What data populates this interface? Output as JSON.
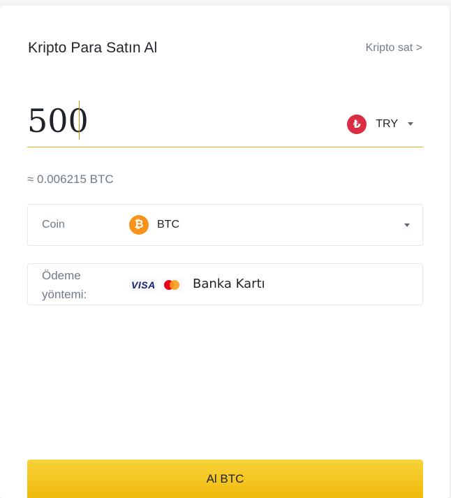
{
  "header": {
    "title": "Kripto Para Satın Al",
    "sell_link": "Kripto sat >"
  },
  "amount": {
    "value": "500",
    "currency_code": "TRY",
    "currency_symbol": "₺",
    "currency_icon": "turkish-lira-icon",
    "currency_color": "#d92d42"
  },
  "estimate": "≈ 0.006215 BTC",
  "coin": {
    "label": "Coin",
    "name": "BTC",
    "symbol": "₿",
    "icon": "bitcoin-icon",
    "color": "#f7931a"
  },
  "payment": {
    "label": "Ödeme yöntemi:",
    "visa_text": "VISA",
    "method": "Banka Kartı"
  },
  "buy_button": {
    "label": "Al BTC",
    "color": "#f0b90b"
  }
}
